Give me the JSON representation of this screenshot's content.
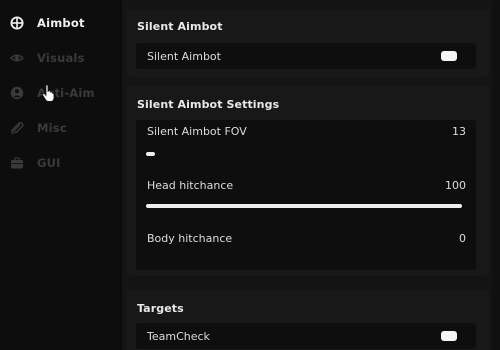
{
  "sidebar": {
    "items": [
      {
        "label": "Aimbot",
        "icon": "crosshair-icon",
        "active": true
      },
      {
        "label": "Visuals",
        "icon": "eye-icon",
        "active": false
      },
      {
        "label": "Anti-Aim",
        "icon": "user-circle-icon",
        "active": false
      },
      {
        "label": "Misc",
        "icon": "paperclip-icon",
        "active": false
      },
      {
        "label": "GUI",
        "icon": "briefcase-icon",
        "active": false
      }
    ]
  },
  "sections": {
    "silent_aimbot": {
      "title": "Silent Aimbot",
      "toggle_label": "Silent Aimbot",
      "toggle_on": true
    },
    "settings": {
      "title": "Silent Aimbot Settings",
      "sliders": [
        {
          "label": "Silent Aimbot FOV",
          "value": "13",
          "fill": 0.03
        },
        {
          "label": "Head hitchance",
          "value": "100",
          "fill": 1.0
        },
        {
          "label": "Body hitchance",
          "value": "0",
          "fill": 0.0
        }
      ]
    },
    "targets": {
      "title": "Targets",
      "toggle_label": "TeamCheck",
      "toggle_on": true
    }
  },
  "colors": {
    "background": "#0b0b0b",
    "panel": "#181818",
    "row": "#0e0e0e",
    "text_active": "#f2f2f2",
    "text_inactive": "#3a3a3a",
    "accent": "#ededed"
  }
}
